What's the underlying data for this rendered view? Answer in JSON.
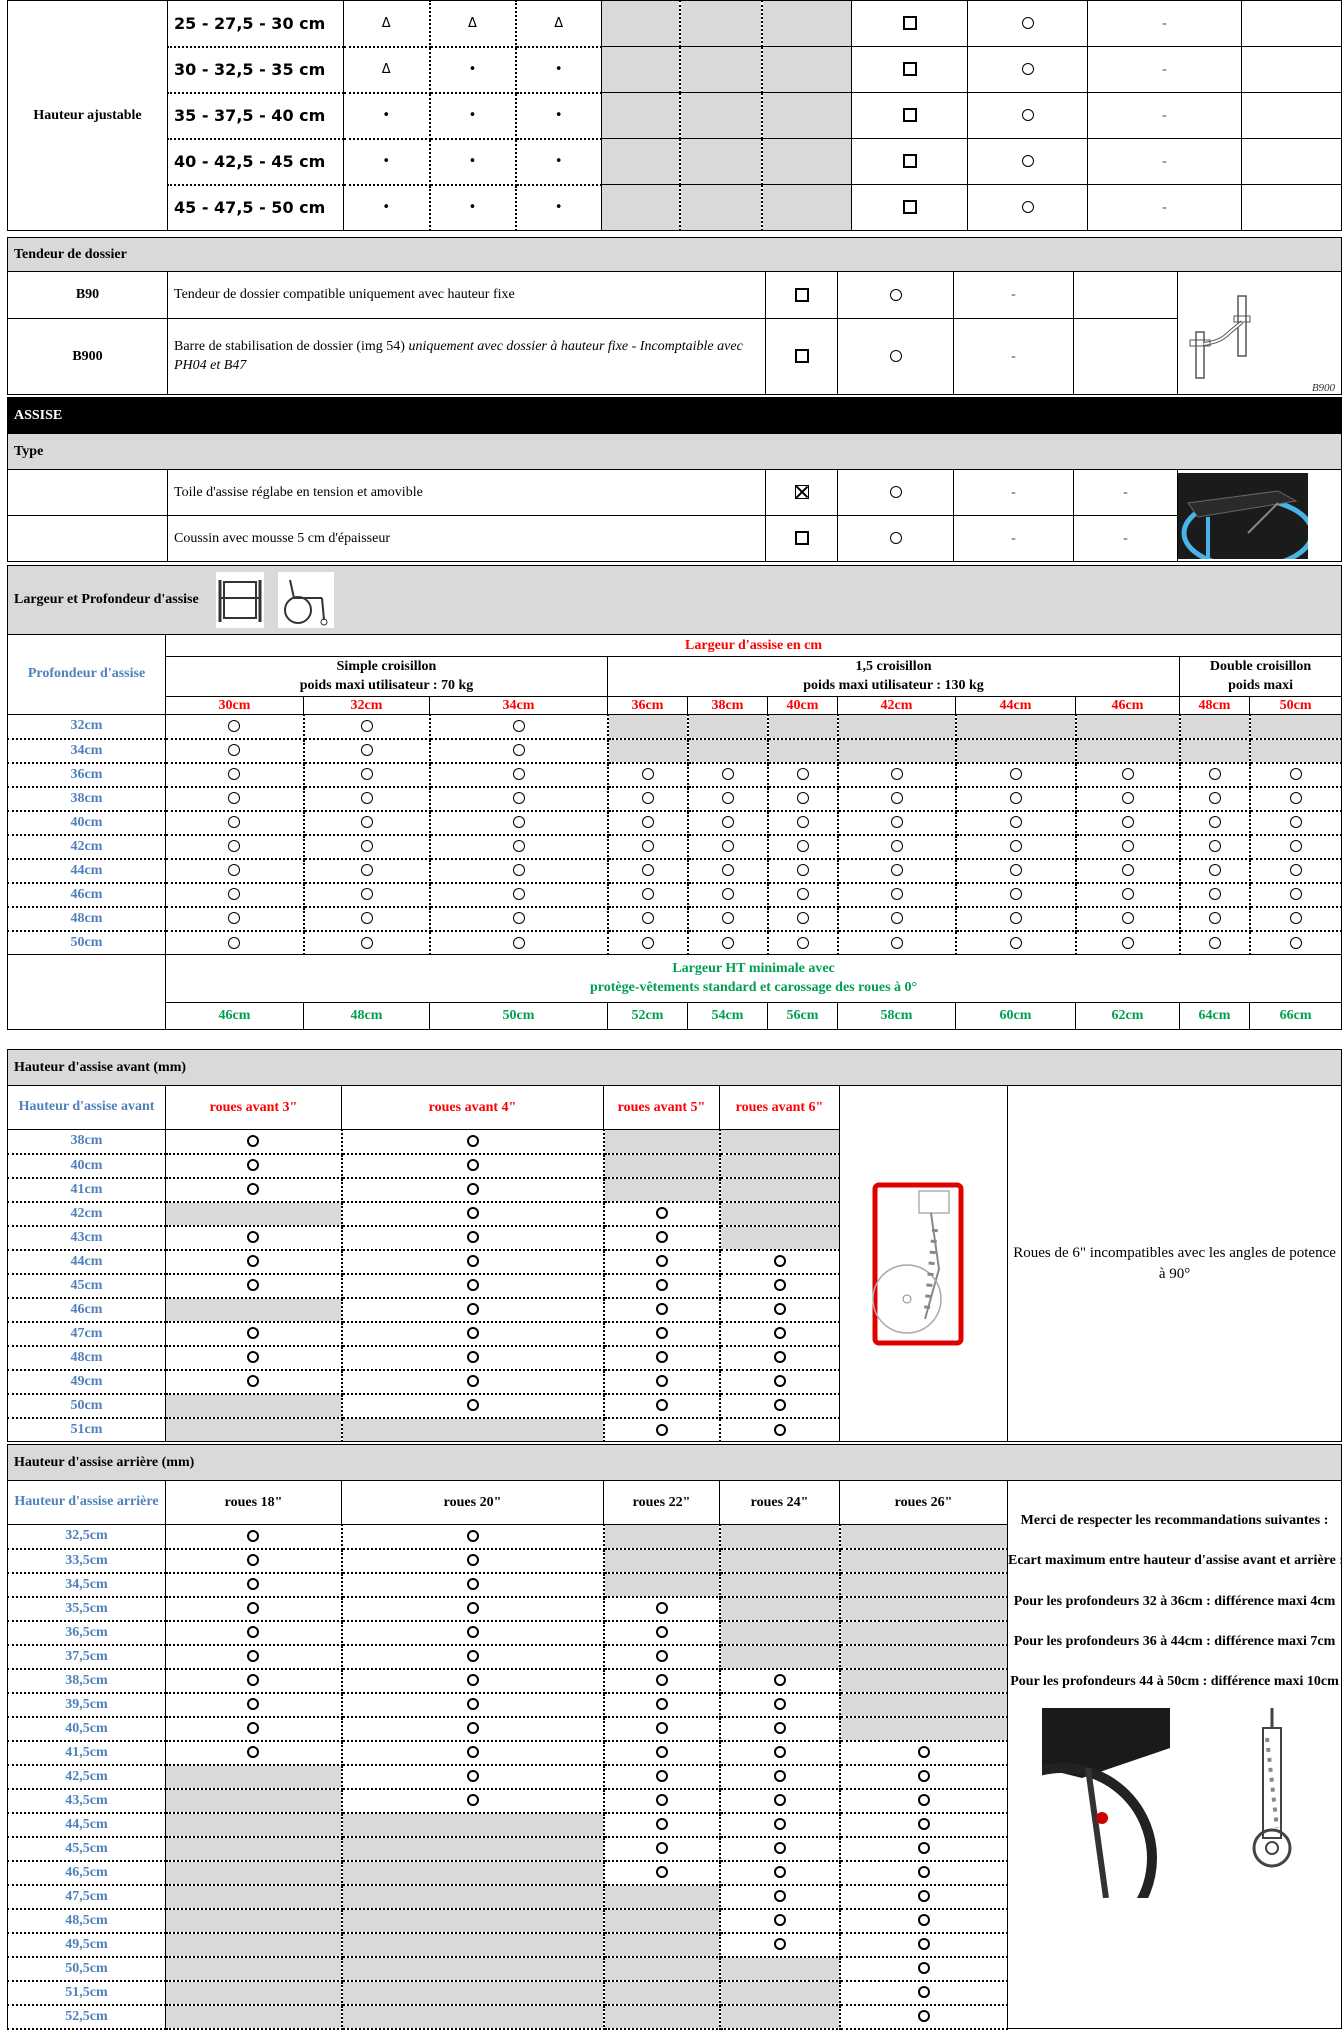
{
  "backrest_height": {
    "row_label": "Hauteur ajustable",
    "rows": [
      {
        "size": "25 - 27,5 - 30 cm",
        "v": [
          "Δ",
          "Δ",
          "Δ"
        ]
      },
      {
        "size": "30 - 32,5 - 35 cm",
        "v": [
          "Δ",
          "•",
          "•"
        ]
      },
      {
        "size": "35 - 37,5 - 40 cm",
        "v": [
          "•",
          "•",
          "•"
        ]
      },
      {
        "size": "40 - 42,5 - 45 cm",
        "v": [
          "•",
          "•",
          "•"
        ]
      },
      {
        "size": "45 - 47,5 - 50 cm",
        "v": [
          "•",
          "•",
          "•"
        ]
      }
    ],
    "dash": "-"
  },
  "tendeur": {
    "title": "Tendeur de dossier",
    "rows": [
      {
        "code": "B90",
        "text": "Tendeur de dossier compatible uniquement avec hauteur fixe",
        "italic": ""
      },
      {
        "code": "B900",
        "text": "Barre de stabilisation de dossier (img 54) ",
        "italic": "uniquement avec dossier à hauteur fixe - Incomptaible avec PH04 et B47"
      }
    ],
    "image_caption": "B900",
    "dash": "-"
  },
  "assise": {
    "title": "ASSISE",
    "type_title": "Type",
    "type_rows": [
      {
        "text": "Toile d'assise réglabe en tension et amovible"
      },
      {
        "text": "Coussin avec mousse 5 cm d'épaisseur"
      }
    ],
    "dash": "-"
  },
  "seat_size": {
    "title": "Largeur et Profondeur d'assise",
    "depth_label": "Profondeur d'assise",
    "width_title": "Largeur d'assise en cm",
    "groups": [
      {
        "name": "Simple croisillon",
        "sub": "poids maxi utilisateur : 70 kg"
      },
      {
        "name": "1,5 croisillon",
        "sub": "poids maxi utilisateur : 130 kg"
      },
      {
        "name": "Double croisillon",
        "sub": "poids maxi"
      }
    ],
    "widths": [
      "30cm",
      "32cm",
      "34cm",
      "36cm",
      "38cm",
      "40cm",
      "42cm",
      "44cm",
      "46cm",
      "48cm",
      "50cm"
    ],
    "depths": [
      "32cm",
      "34cm",
      "36cm",
      "38cm",
      "40cm",
      "42cm",
      "44cm",
      "46cm",
      "48cm",
      "50cm"
    ],
    "ht_title_1": "Largeur HT minimale avec",
    "ht_title_2": "protège-vêtements standard et carossage des roues à 0°",
    "ht_widths": [
      "46cm",
      "48cm",
      "50cm",
      "52cm",
      "54cm",
      "56cm",
      "58cm",
      "60cm",
      "62cm",
      "64cm",
      "66cm"
    ]
  },
  "front_height": {
    "title": "Hauteur d'assise avant (mm)",
    "label": "Hauteur d'assise avant",
    "columns": [
      "roues avant 3\"",
      "roues avant 4\"",
      "roues avant 5\"",
      "roues avant 6\""
    ],
    "rows": [
      "38cm",
      "40cm",
      "41cm",
      "42cm",
      "43cm",
      "44cm",
      "45cm",
      "46cm",
      "47cm",
      "48cm",
      "49cm",
      "50cm",
      "51cm"
    ],
    "note": "Roues de 6\" incompatibles avec les angles de potence à 90°"
  },
  "rear_height": {
    "title": "Hauteur d'assise arrière (mm)",
    "label": "Hauteur d'assise arrière",
    "columns": [
      "roues 18\"",
      "roues 20\"",
      "roues 22\"",
      "roues 24\"",
      "roues 26\""
    ],
    "rows": [
      "32,5cm",
      "33,5cm",
      "34,5cm",
      "35,5cm",
      "36,5cm",
      "37,5cm",
      "38,5cm",
      "39,5cm",
      "40,5cm",
      "41,5cm",
      "42,5cm",
      "43,5cm",
      "44,5cm",
      "45,5cm",
      "46,5cm",
      "47,5cm",
      "48,5cm",
      "49,5cm",
      "50,5cm",
      "51,5cm",
      "52,5cm"
    ],
    "notes": [
      "Merci de respecter les recommandations suivantes :",
      "Ecart maximum entre hauteur d'assise avant et arrière :",
      "Pour les profondeurs 32 à 36cm : différence maxi 4cm",
      "Pour les profondeurs 36 à 44cm : différence maxi 7cm",
      "Pour les profondeurs 44 à 50cm : différence maxi 10cm"
    ]
  }
}
